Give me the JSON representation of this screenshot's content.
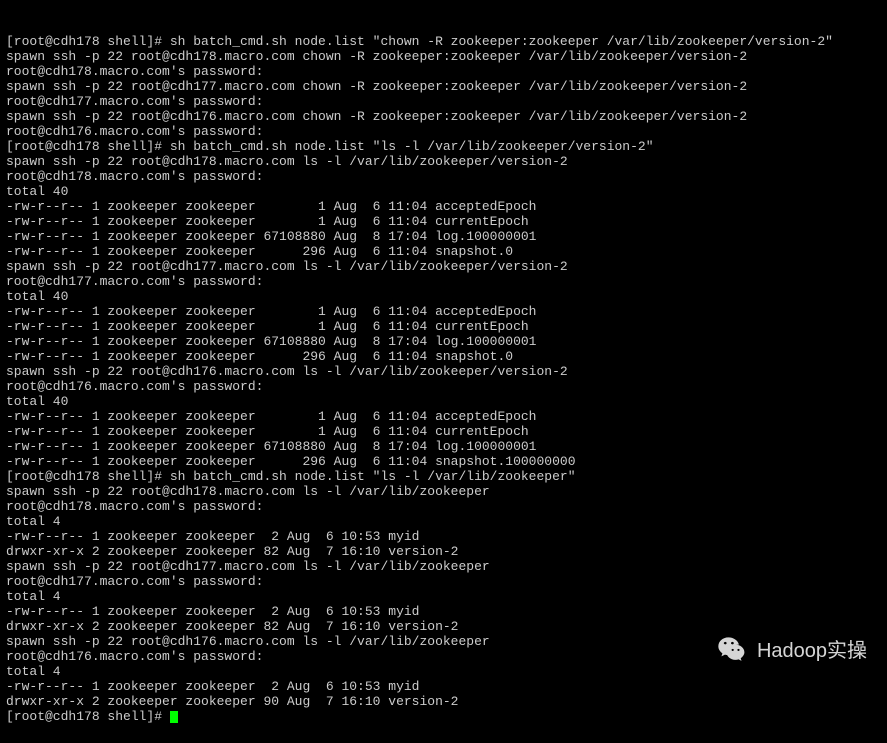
{
  "terminal": {
    "lines": [
      "[root@cdh178 shell]# sh batch_cmd.sh node.list \"chown -R zookeeper:zookeeper /var/lib/zookeeper/version-2\"",
      "spawn ssh -p 22 root@cdh178.macro.com chown -R zookeeper:zookeeper /var/lib/zookeeper/version-2",
      "root@cdh178.macro.com's password: ",
      "spawn ssh -p 22 root@cdh177.macro.com chown -R zookeeper:zookeeper /var/lib/zookeeper/version-2",
      "root@cdh177.macro.com's password: ",
      "spawn ssh -p 22 root@cdh176.macro.com chown -R zookeeper:zookeeper /var/lib/zookeeper/version-2",
      "root@cdh176.macro.com's password: ",
      "[root@cdh178 shell]# sh batch_cmd.sh node.list \"ls -l /var/lib/zookeeper/version-2\"",
      "spawn ssh -p 22 root@cdh178.macro.com ls -l /var/lib/zookeeper/version-2",
      "root@cdh178.macro.com's password: ",
      "total 40",
      "-rw-r--r-- 1 zookeeper zookeeper        1 Aug  6 11:04 acceptedEpoch",
      "-rw-r--r-- 1 zookeeper zookeeper        1 Aug  6 11:04 currentEpoch",
      "-rw-r--r-- 1 zookeeper zookeeper 67108880 Aug  8 17:04 log.100000001",
      "-rw-r--r-- 1 zookeeper zookeeper      296 Aug  6 11:04 snapshot.0",
      "spawn ssh -p 22 root@cdh177.macro.com ls -l /var/lib/zookeeper/version-2",
      "root@cdh177.macro.com's password: ",
      "total 40",
      "-rw-r--r-- 1 zookeeper zookeeper        1 Aug  6 11:04 acceptedEpoch",
      "-rw-r--r-- 1 zookeeper zookeeper        1 Aug  6 11:04 currentEpoch",
      "-rw-r--r-- 1 zookeeper zookeeper 67108880 Aug  8 17:04 log.100000001",
      "-rw-r--r-- 1 zookeeper zookeeper      296 Aug  6 11:04 snapshot.0",
      "spawn ssh -p 22 root@cdh176.macro.com ls -l /var/lib/zookeeper/version-2",
      "root@cdh176.macro.com's password: ",
      "total 40",
      "-rw-r--r-- 1 zookeeper zookeeper        1 Aug  6 11:04 acceptedEpoch",
      "-rw-r--r-- 1 zookeeper zookeeper        1 Aug  6 11:04 currentEpoch",
      "-rw-r--r-- 1 zookeeper zookeeper 67108880 Aug  8 17:04 log.100000001",
      "-rw-r--r-- 1 zookeeper zookeeper      296 Aug  6 11:04 snapshot.100000000",
      "[root@cdh178 shell]# sh batch_cmd.sh node.list \"ls -l /var/lib/zookeeper\"",
      "spawn ssh -p 22 root@cdh178.macro.com ls -l /var/lib/zookeeper",
      "root@cdh178.macro.com's password: ",
      "total 4",
      "-rw-r--r-- 1 zookeeper zookeeper  2 Aug  6 10:53 myid",
      "drwxr-xr-x 2 zookeeper zookeeper 82 Aug  7 16:10 version-2",
      "spawn ssh -p 22 root@cdh177.macro.com ls -l /var/lib/zookeeper",
      "root@cdh177.macro.com's password: ",
      "total 4",
      "-rw-r--r-- 1 zookeeper zookeeper  2 Aug  6 10:53 myid",
      "drwxr-xr-x 2 zookeeper zookeeper 82 Aug  7 16:10 version-2",
      "spawn ssh -p 22 root@cdh176.macro.com ls -l /var/lib/zookeeper",
      "root@cdh176.macro.com's password: ",
      "total 4",
      "-rw-r--r-- 1 zookeeper zookeeper  2 Aug  6 10:53 myid",
      "drwxr-xr-x 2 zookeeper zookeeper 90 Aug  7 16:10 version-2"
    ],
    "prompt": "[root@cdh178 shell]# "
  },
  "watermark": {
    "text": "Hadoop实操"
  }
}
